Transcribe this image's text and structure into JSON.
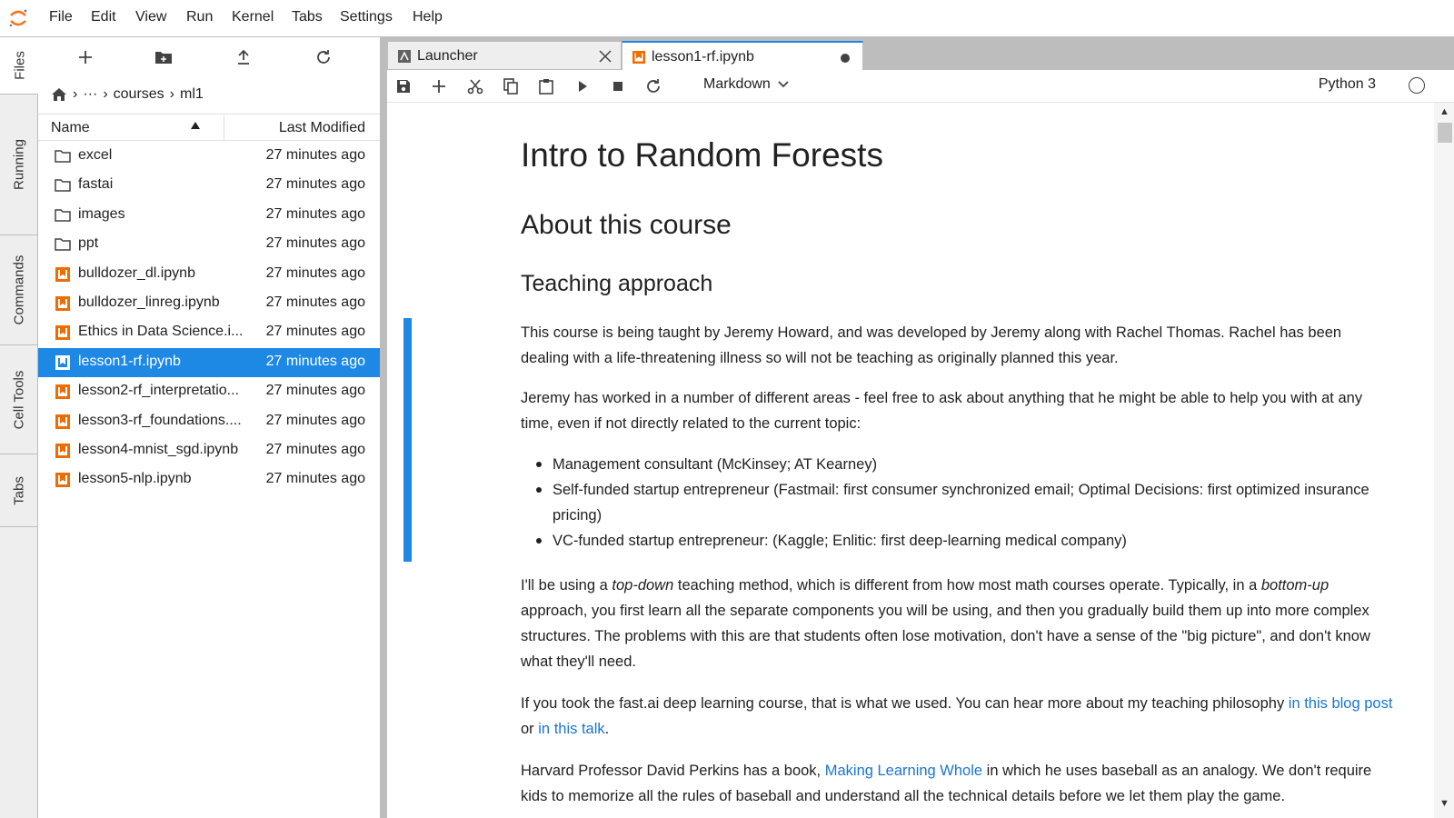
{
  "menu": [
    "File",
    "Edit",
    "View",
    "Run",
    "Kernel",
    "Tabs",
    "Settings",
    "Help"
  ],
  "sidebar_tabs": [
    "Files",
    "Running",
    "Commands",
    "Cell Tools",
    "Tabs"
  ],
  "breadcrumbs": {
    "ellipsis": "···",
    "path": [
      "courses",
      "ml1"
    ]
  },
  "listing_header": {
    "name": "Name",
    "modified": "Last Modified"
  },
  "files": [
    {
      "name": "excel",
      "type": "folder",
      "modified": "27 minutes ago"
    },
    {
      "name": "fastai",
      "type": "folder",
      "modified": "27 minutes ago"
    },
    {
      "name": "images",
      "type": "folder",
      "modified": "27 minutes ago"
    },
    {
      "name": "ppt",
      "type": "folder",
      "modified": "27 minutes ago"
    },
    {
      "name": "bulldozer_dl.ipynb",
      "type": "notebook",
      "modified": "27 minutes ago"
    },
    {
      "name": "bulldozer_linreg.ipynb",
      "type": "notebook",
      "modified": "27 minutes ago"
    },
    {
      "name": "Ethics in Data Science.i...",
      "type": "notebook",
      "modified": "27 minutes ago"
    },
    {
      "name": "lesson1-rf.ipynb",
      "type": "notebook",
      "modified": "27 minutes ago",
      "selected": true
    },
    {
      "name": "lesson2-rf_interpretatio...",
      "type": "notebook",
      "modified": "27 minutes ago"
    },
    {
      "name": "lesson3-rf_foundations....",
      "type": "notebook",
      "modified": "27 minutes ago"
    },
    {
      "name": "lesson4-mnist_sgd.ipynb",
      "type": "notebook",
      "modified": "27 minutes ago"
    },
    {
      "name": "lesson5-nlp.ipynb",
      "type": "notebook",
      "modified": "27 minutes ago"
    }
  ],
  "tabs": [
    {
      "label": "Launcher",
      "active": false
    },
    {
      "label": "lesson1-rf.ipynb",
      "active": true
    }
  ],
  "toolbar": {
    "cell_type": "Markdown",
    "kernel": "Python 3"
  },
  "notebook": {
    "h1": "Intro to Random Forests",
    "h2": "About this course",
    "h3": "Teaching approach",
    "p1": "This course is being taught by Jeremy Howard, and was developed by Jeremy along with Rachel Thomas. Rachel has been dealing with a life-threatening illness so will not be teaching as originally planned this year.",
    "p2": "Jeremy has worked in a number of different areas - feel free to ask about anything that he might be able to help you with at any time, even if not directly related to the current topic:",
    "bullets": [
      "Management consultant (McKinsey; AT Kearney)",
      "Self-funded startup entrepreneur (Fastmail: first consumer synchronized email; Optimal Decisions: first optimized insurance pricing)",
      "VC-funded startup entrepreneur: (Kaggle; Enlitic: first deep-learning medical company)"
    ],
    "p3": {
      "a": "I'll be using a ",
      "em1": "top-down",
      "b": " teaching method, which is different from how most math courses operate. Typically, in a ",
      "em2": "bottom-up",
      "c": " approach, you first learn all the separate components you will be using, and then you gradually build them up into more complex structures. The problems with this are that students often lose motivation, don't have a sense of the \"big picture\", and don't know what they'll need."
    },
    "p4": {
      "a": "If you took the fast.ai deep learning course, that is what we used. You can hear more about my teaching philosophy ",
      "link1": "in this blog post",
      "b": " or ",
      "link2": "in this talk",
      "c": "."
    },
    "p5": {
      "a": "Harvard Professor David Perkins has a book, ",
      "link": "Making Learning Whole",
      "b": " in which he uses baseball as an analogy. We don't require kids to memorize all the rules of baseball and understand all the technical details before we let them play the game."
    }
  },
  "colors": {
    "accent": "#1e88e5",
    "notebook_icon": "#ef6c00",
    "link": "#1976d2"
  }
}
